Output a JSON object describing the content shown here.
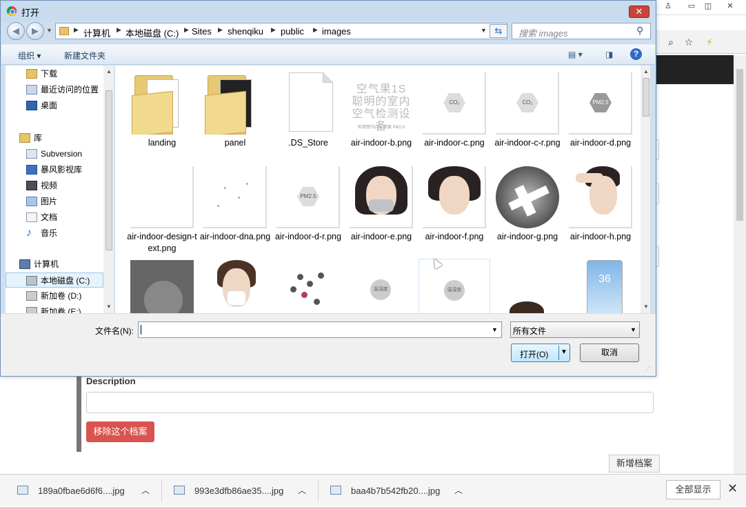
{
  "dialog": {
    "title": "打开",
    "close_glyph": "✕",
    "back_glyph": "◀",
    "forward_glyph": "▶",
    "breadcrumbs": [
      "计算机",
      "本地磁盘 (C:)",
      "Sites",
      "shenqiku",
      "public",
      "images"
    ],
    "search_placeholder": "搜索 images",
    "toolbar": {
      "organize": "组织 ▾",
      "new_folder": "新建文件夹"
    },
    "nav": [
      {
        "label": "下载",
        "icon": "download-folder-icon"
      },
      {
        "label": "最近访问的位置",
        "icon": "recent-places-icon"
      },
      {
        "label": "桌面",
        "icon": "desktop-icon"
      },
      {
        "label": "库",
        "icon": "library-icon"
      },
      {
        "label": "Subversion",
        "icon": "subversion-icon"
      },
      {
        "label": "暴风影视库",
        "icon": "video-library-icon"
      },
      {
        "label": "视频",
        "icon": "video-icon"
      },
      {
        "label": "图片",
        "icon": "pictures-icon"
      },
      {
        "label": "文档",
        "icon": "documents-icon"
      },
      {
        "label": "音乐",
        "icon": "music-icon"
      },
      {
        "label": "计算机",
        "icon": "computer-icon"
      },
      {
        "label": "本地磁盘 (C:)",
        "icon": "drive-c-icon"
      },
      {
        "label": "新加卷 (D:)",
        "icon": "drive-d-icon"
      },
      {
        "label": "新加卷 (E:)",
        "icon": "drive-e-icon"
      }
    ],
    "files": [
      {
        "name": "landing",
        "kind": "folder"
      },
      {
        "name": "panel",
        "kind": "folder"
      },
      {
        "name": ".DS_Store",
        "kind": "file"
      },
      {
        "name": "air-indoor-b.png",
        "kind": "image"
      },
      {
        "name": "air-indoor-c.png",
        "kind": "image"
      },
      {
        "name": "air-indoor-c-r.png",
        "kind": "image"
      },
      {
        "name": "air-indoor-d.png",
        "kind": "image"
      },
      {
        "name": "air-indoor-design-text.png",
        "kind": "image"
      },
      {
        "name": "air-indoor-dna.png",
        "kind": "image"
      },
      {
        "name": "air-indoor-d-r.png",
        "kind": "image"
      },
      {
        "name": "air-indoor-e.png",
        "kind": "image"
      },
      {
        "name": "air-indoor-f.png",
        "kind": "image"
      },
      {
        "name": "air-indoor-g.png",
        "kind": "image"
      },
      {
        "name": "air-indoor-h.png",
        "kind": "image"
      }
    ],
    "thumb_text": {
      "b_heading": "空气果1S 聪明的室内 空气检测设备",
      "b_sub": "检测室内CO₂ 浓度 PM2.5",
      "co2": "CO₂",
      "pm25": "PM2.5",
      "wet": "温湿度",
      "phone_value": "36"
    },
    "filename_label": "文件名(N):",
    "filename_value": "",
    "filetype": "所有文件",
    "open_button": "打开(O)",
    "cancel_button": "取消"
  },
  "page": {
    "description_label": "Description",
    "remove_button": "移除这个档案",
    "add_button": "新增档案"
  },
  "downloads": {
    "items": [
      "189a0fbae6d6f6....jpg",
      "993e3dfb86ae35....jpg",
      "baa4b7b542fb20....jpg"
    ],
    "show_all": "全部显示"
  },
  "colors": {
    "danger": "#d9534f",
    "dialog_frame": "#cfdff0",
    "selection": "#e5f3fb"
  }
}
